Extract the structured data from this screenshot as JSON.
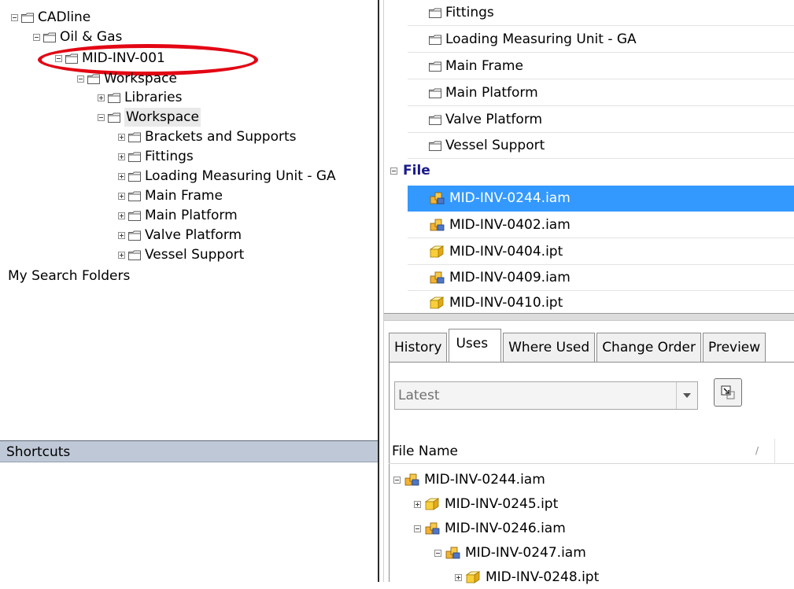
{
  "left_tree": {
    "items": [
      {
        "label": "CADline",
        "expander": "minus"
      },
      {
        "label": "Oil & Gas",
        "expander": "minus"
      },
      {
        "label": "MID-INV-001",
        "expander": "minus"
      },
      {
        "label": "Workspace",
        "expander": "minus"
      },
      {
        "label": "Libraries",
        "expander": "plus"
      },
      {
        "label": "Workspace",
        "expander": "minus"
      },
      {
        "label": "Brackets and Supports",
        "expander": "plus"
      },
      {
        "label": "Fittings",
        "expander": "plus"
      },
      {
        "label": "Loading Measuring Unit - GA",
        "expander": "plus"
      },
      {
        "label": "Main Frame",
        "expander": "plus"
      },
      {
        "label": "Main Platform",
        "expander": "plus"
      },
      {
        "label": "Valve Platform",
        "expander": "plus"
      },
      {
        "label": "Vessel Support",
        "expander": "plus"
      }
    ],
    "search_folders": "My Search Folders",
    "highlight_color": "#e30613"
  },
  "shortcuts": {
    "label": "Shortcuts"
  },
  "main_list": {
    "folders": [
      "Fittings",
      "Loading Measuring Unit - GA",
      "Main Frame",
      "Main Platform",
      "Valve Platform",
      "Vessel Support"
    ],
    "file_group": "File",
    "files": [
      {
        "name": "MID-INV-0244.iam",
        "type": "assembly",
        "selected": true
      },
      {
        "name": "MID-INV-0402.iam",
        "type": "assembly"
      },
      {
        "name": "MID-INV-0404.ipt",
        "type": "part"
      },
      {
        "name": "MID-INV-0409.iam",
        "type": "assembly"
      },
      {
        "name": "MID-INV-0410.ipt",
        "type": "part"
      }
    ],
    "selected_color": "#3399ff"
  },
  "details": {
    "tabs": [
      "History",
      "Uses",
      "Where Used",
      "Change Order",
      "Preview"
    ],
    "active_tab": "Uses",
    "version_select": "Latest",
    "grid_header": "File Name",
    "rows": [
      {
        "name": "MID-INV-0244.iam",
        "type": "assembly",
        "expander": "minus"
      },
      {
        "name": "MID-INV-0245.ipt",
        "type": "part",
        "expander": "plus"
      },
      {
        "name": "MID-INV-0246.iam",
        "type": "assembly",
        "expander": "minus"
      },
      {
        "name": "MID-INV-0247.iam",
        "type": "assembly",
        "expander": "minus"
      },
      {
        "name": "MID-INV-0248.ipt",
        "type": "part",
        "expander": "plus"
      }
    ]
  }
}
